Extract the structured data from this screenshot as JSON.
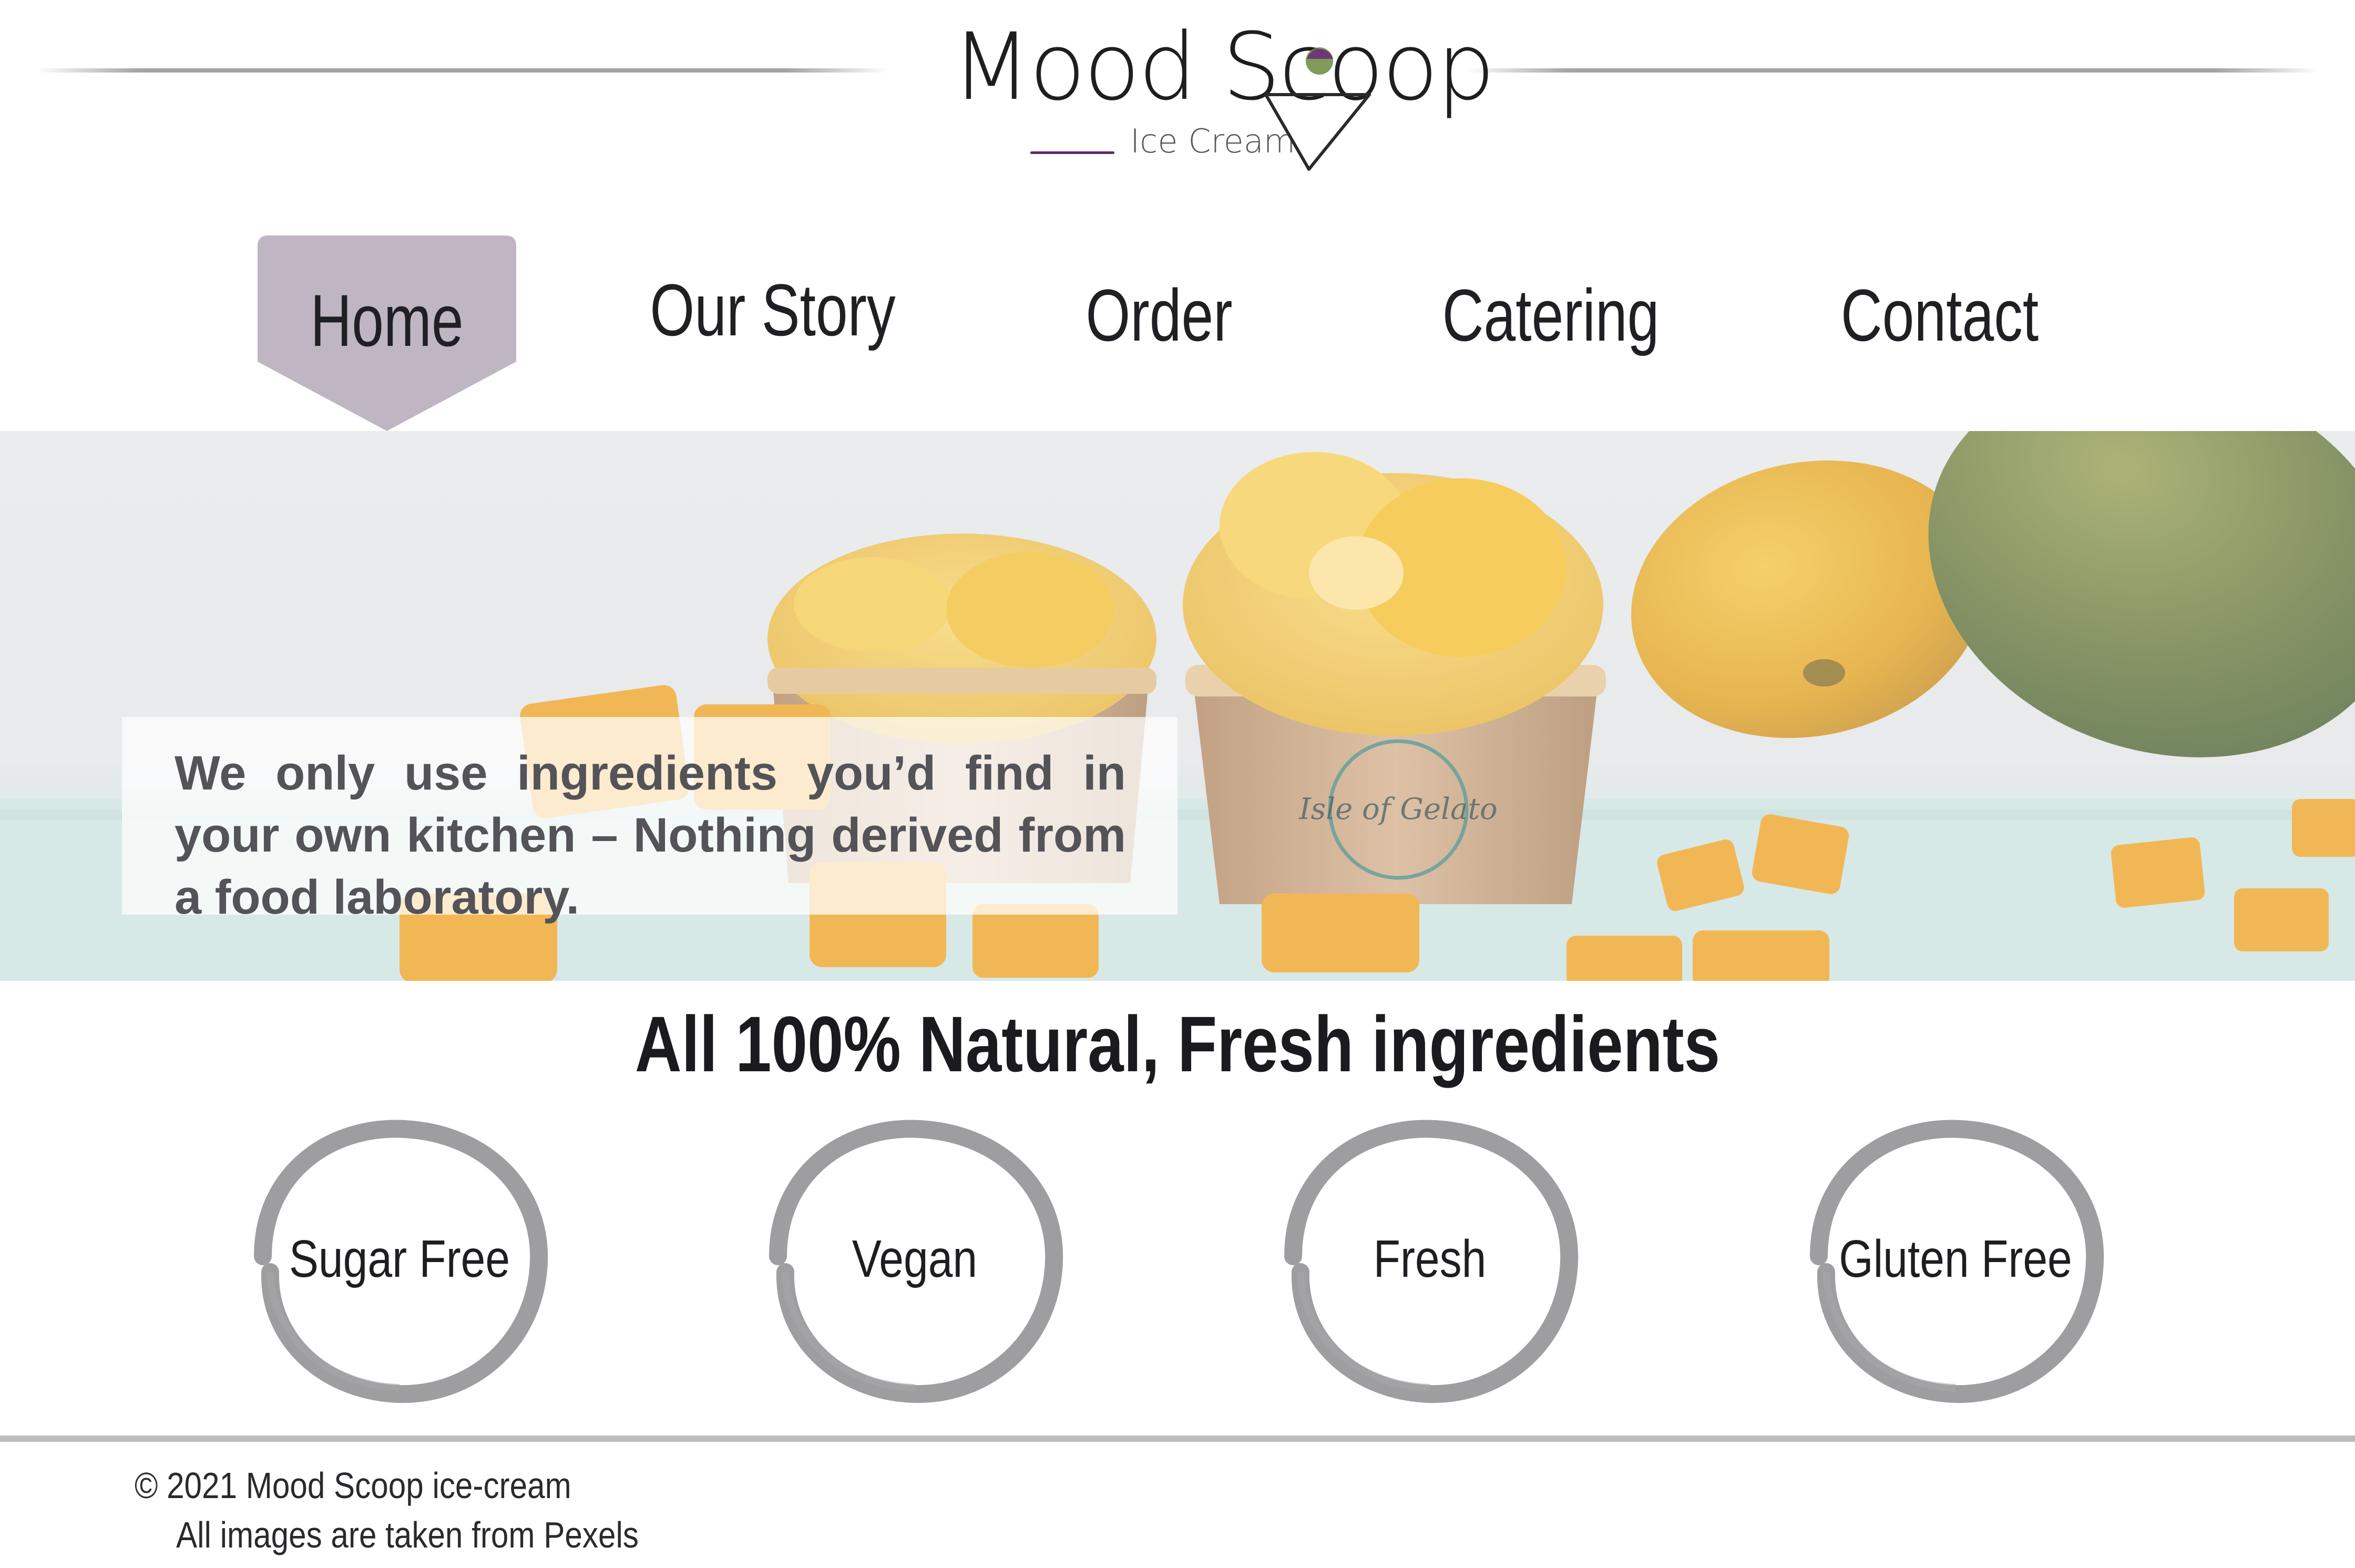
{
  "brand": {
    "name": "Mood Scoop",
    "tagline": "Ice Cream",
    "accent_color": "#5b2a6e",
    "cone_color": "#2a2a2a",
    "scoop_color": "#6b8a3e"
  },
  "nav": {
    "items": [
      {
        "label": "Home",
        "active": true
      },
      {
        "label": "Our Story",
        "active": false
      },
      {
        "label": "Order",
        "active": false
      },
      {
        "label": "Catering",
        "active": false
      },
      {
        "label": "Contact",
        "active": false
      }
    ],
    "active_color": "#bfb5c3"
  },
  "hero": {
    "text": "We only use ingredients you’d find in your own kitchen – Nothing derived from a food laboratory.",
    "image": "mango-ice-cream-cups",
    "cup_label": "Isle of Gelato"
  },
  "features": {
    "title": "All 100% Natural, Fresh ingredients",
    "items": [
      {
        "label": "Sugar Free",
        "icon": "brush-circle-icon"
      },
      {
        "label": "Vegan",
        "icon": "brush-circle-icon"
      },
      {
        "label": "Fresh",
        "icon": "brush-circle-icon"
      },
      {
        "label": "Gluten Free",
        "icon": "brush-circle-icon"
      }
    ]
  },
  "footer": {
    "copyright": "© 2021 Mood Scoop ice-cream",
    "credit": "All images are taken from Pexels"
  }
}
